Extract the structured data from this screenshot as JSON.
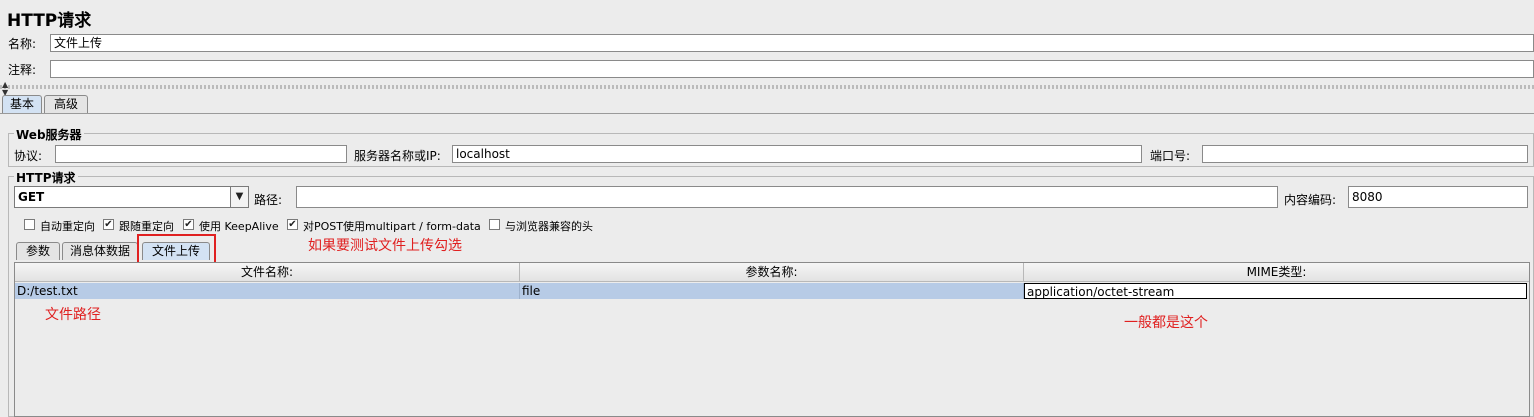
{
  "title": "HTTP请求",
  "name_label": "名称:",
  "name_value": "文件上传",
  "comment_label": "注释:",
  "comment_value": "",
  "main_tabs": [
    "基本",
    "高级"
  ],
  "web_server": {
    "legend": "Web服务器",
    "protocol_label": "协议:",
    "protocol_value": "",
    "server_label": "服务器名称或IP:",
    "server_value": "localhost",
    "port_label": "端口号:",
    "port_value": ""
  },
  "http_request": {
    "legend": "HTTP请求",
    "method": "GET",
    "path_label": "路径:",
    "path_value": "",
    "encoding_label": "内容编码:",
    "encoding_value": "8080"
  },
  "checkboxes": [
    {
      "label": "自动重定向",
      "checked": false
    },
    {
      "label": "跟随重定向",
      "checked": true
    },
    {
      "label": "使用 KeepAlive",
      "checked": true
    },
    {
      "label": "对POST使用multipart / form-data",
      "checked": true
    },
    {
      "label": "与浏览器兼容的头",
      "checked": false
    }
  ],
  "sub_tabs": [
    "参数",
    "消息体数据",
    "文件上传"
  ],
  "table": {
    "headers": [
      "文件名称:",
      "参数名称:",
      "MIME类型:"
    ],
    "row": [
      "D:/test.txt",
      "file",
      "application/octet-stream"
    ]
  },
  "annotations": {
    "upload_hint": "如果要测试文件上传勾选",
    "file_path": "文件路径",
    "mime_hint": "一般都是这个"
  },
  "colors": {
    "annotation": "#e02020",
    "selected_row": "#b7cbe6",
    "selected_tab": "#d3e2f3"
  }
}
